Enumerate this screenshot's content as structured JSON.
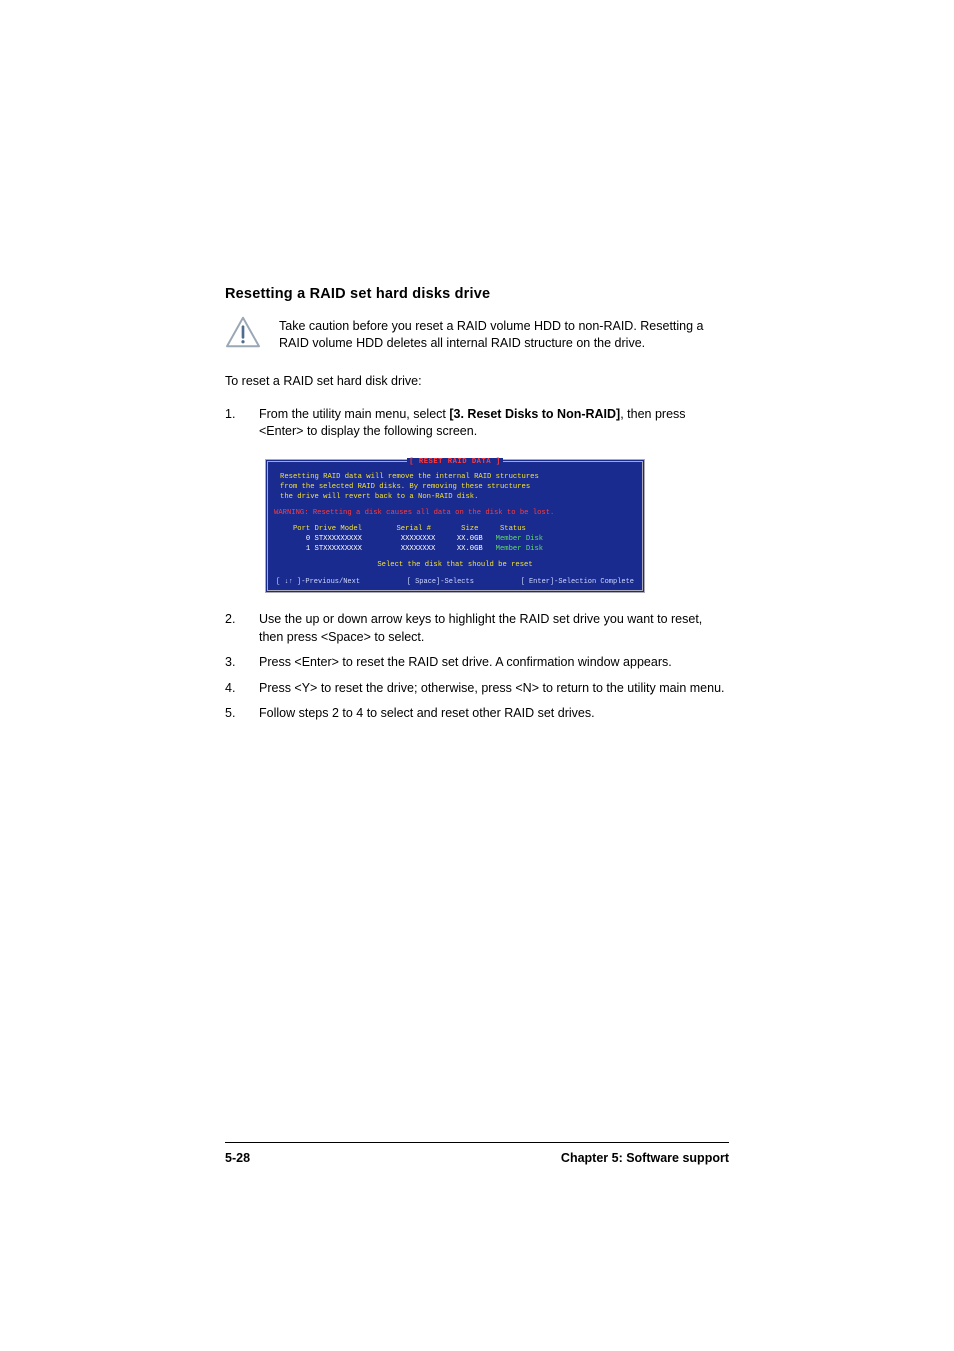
{
  "heading": "Resetting a RAID set hard disks drive",
  "caution": "Take caution before you reset a RAID volume HDD to non-RAID. Resetting a RAID volume HDD deletes all internal RAID structure on the drive.",
  "intro": "To reset a RAID set hard disk drive:",
  "steps": {
    "1": {
      "num": "1.",
      "pre": "From the utility main menu, select ",
      "bold": "[3. Reset Disks to Non-RAID]",
      "post": ", then press <Enter> to display the following screen."
    },
    "2": {
      "num": "2.",
      "text": "Use the up or down arrow keys to highlight the RAID set drive you want to reset, then press <Space> to select."
    },
    "3": {
      "num": "3.",
      "text": "Press <Enter> to reset the RAID set drive. A confirmation window appears."
    },
    "4": {
      "num": "4.",
      "text": "Press <Y> to reset the drive; otherwise, press <N> to return to the utility main menu."
    },
    "5": {
      "num": "5.",
      "text": "Follow steps 2 to 4 to select and reset other RAID set drives."
    }
  },
  "terminal": {
    "title": "[ RESET RAID DATA ]",
    "msg1": "Resetting RAID data will remove the internal RAID structures",
    "msg2": "from the selected RAID disks. By removing these structures",
    "msg3": "the drive will revert back to a Non-RAID disk.",
    "warn": "WARNING: Resetting a disk causes all data on the disk to be lost.",
    "hdr": "   Port Drive Model        Serial #       Size     Status",
    "row1_l": "      0 STXXXXXXXXX         XXXXXXXX     XX.0GB   ",
    "row1_r": "Member Disk",
    "row2_l": "      1 STXXXXXXXXX         XXXXXXXX     XX.0GB   ",
    "row2_r": "Member Disk",
    "prompt": "Select the disk that should be reset",
    "ft_left": "[ ↓↑ ]-Previous/Next",
    "ft_mid": "[ Space]-Selects",
    "ft_right": "[ Enter]-Selection Complete"
  },
  "footer": {
    "left": "5-28",
    "right": "Chapter 5: Software support"
  }
}
